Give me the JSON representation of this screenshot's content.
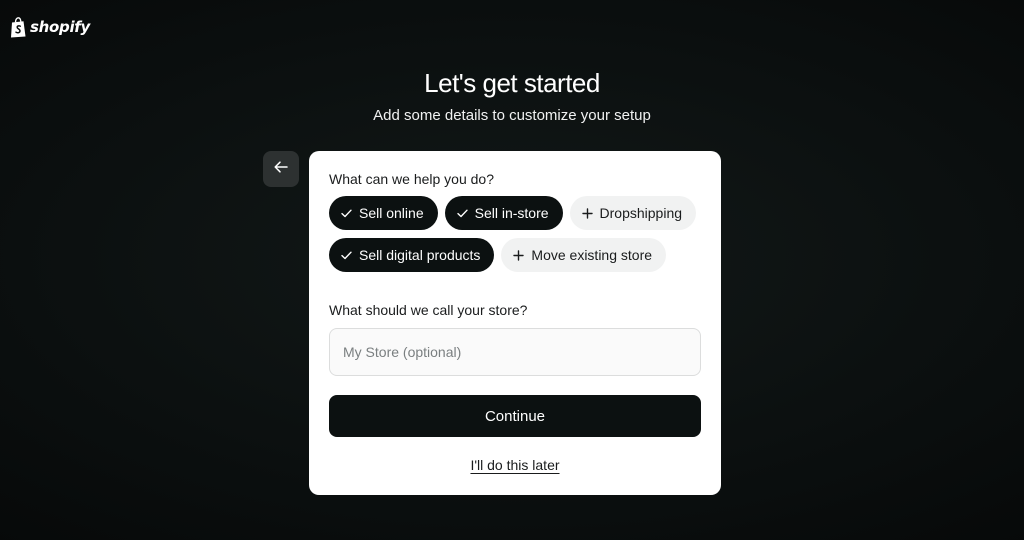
{
  "brand": {
    "logo_text": "shopify",
    "icon": "shopify-bag-icon"
  },
  "header": {
    "title": "Let's get started",
    "subtitle": "Add some details to customize your setup"
  },
  "back_button": {
    "icon": "arrow-left-icon"
  },
  "form": {
    "help_question": "What can we help you do?",
    "options": [
      {
        "label": "Sell online",
        "selected": true,
        "icon": "check-icon"
      },
      {
        "label": "Sell in-store",
        "selected": true,
        "icon": "check-icon"
      },
      {
        "label": "Dropshipping",
        "selected": false,
        "icon": "plus-icon"
      },
      {
        "label": "Sell digital products",
        "selected": true,
        "icon": "check-icon"
      },
      {
        "label": "Move existing store",
        "selected": false,
        "icon": "plus-icon"
      }
    ],
    "store_name_question": "What should we call your store?",
    "store_name": {
      "value": "",
      "placeholder": "My Store (optional)"
    },
    "continue_label": "Continue",
    "later_label": "I'll do this later"
  },
  "colors": {
    "background": "#0b0f0f",
    "card": "#ffffff",
    "selected_chip": "#0c1111",
    "unselected_chip": "#f1f2f2",
    "primary_button": "#0c1111",
    "back_button": "#2d3131"
  }
}
